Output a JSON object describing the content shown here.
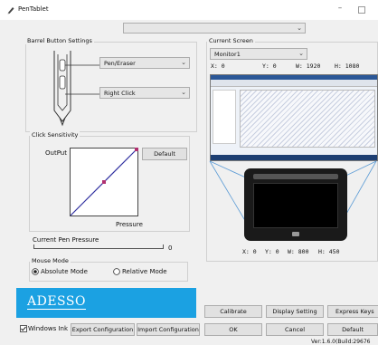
{
  "window": {
    "title": "PenTablet",
    "minimize": "–"
  },
  "top_combo": {
    "value": ""
  },
  "barrel": {
    "group_label": "Barrel Button Settings",
    "upper_value": "Pen/Eraser",
    "lower_value": "Right Click"
  },
  "sensitivity": {
    "group_label": "Click Sensitivity",
    "output_label": "OutPut",
    "default_label": "Default",
    "pressure_label": "Pressure"
  },
  "current_pressure": {
    "label": "Current Pen Pressure",
    "value": "0"
  },
  "mouse_mode": {
    "group_label": "Mouse Mode",
    "absolute_label": "Absolute Mode",
    "relative_label": "Relative Mode",
    "selected": "absolute"
  },
  "brand": {
    "logo_text": "ADESSO"
  },
  "current_screen": {
    "group_label": "Current Screen",
    "monitor_value": "Monitor1",
    "screen_x": "X:  0",
    "screen_y": "Y:  0",
    "screen_w": "W:  1920",
    "screen_h": "H:  1080",
    "tablet_x": "X: 0",
    "tablet_y": "Y: 0",
    "tablet_w": "W: 800",
    "tablet_h": "H: 450"
  },
  "buttons": {
    "calibrate": "Calibrate",
    "display_setting": "Display Setting",
    "express_keys": "Express Keys",
    "windows_ink": "Windows Ink",
    "export_config": "Export Configuration",
    "import_config": "Import Configuration",
    "ok": "OK",
    "cancel": "Cancel",
    "default": "Default"
  },
  "version": "Ver:1.6.0(Build:29676",
  "colors": {
    "accent": "#1ba1e2",
    "pressure_curve": "#3030a0",
    "curve_point": "#b03070"
  }
}
